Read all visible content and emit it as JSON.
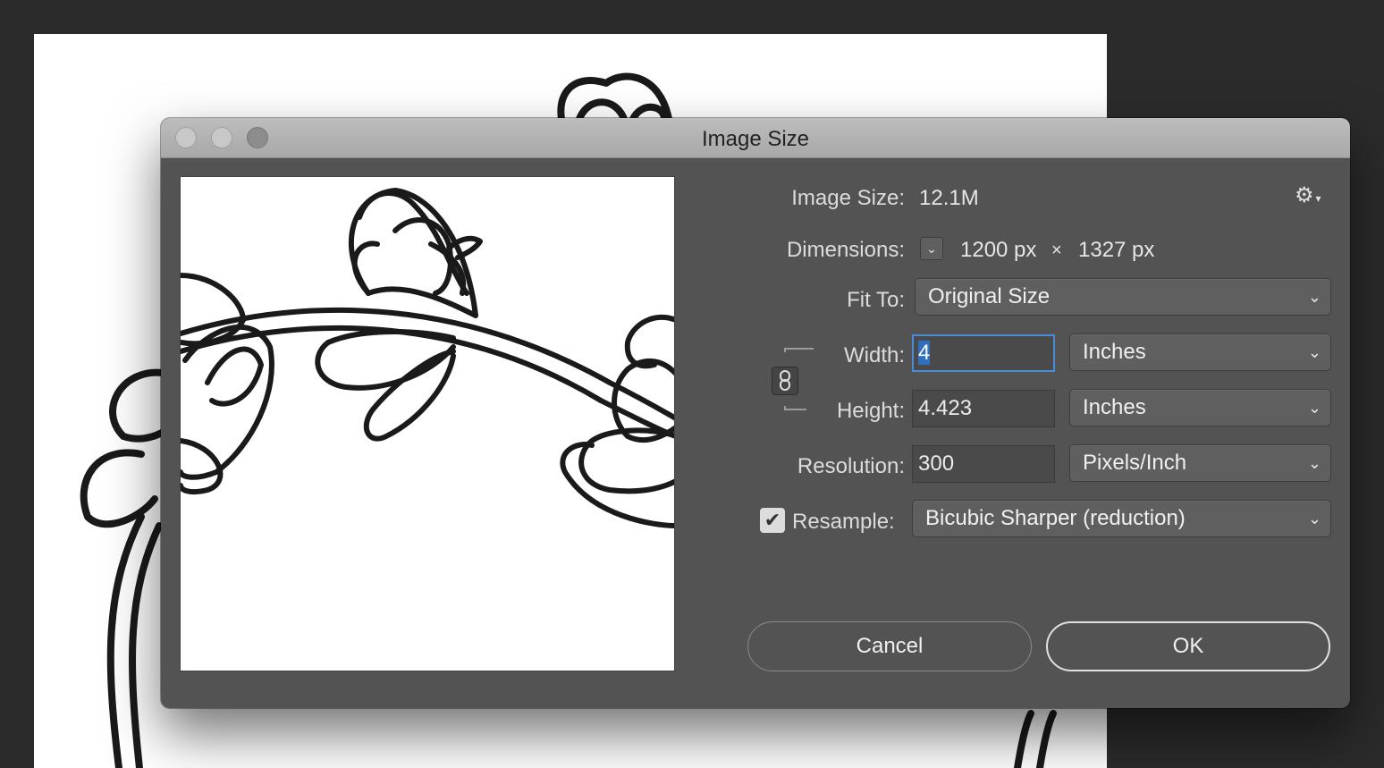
{
  "dialog": {
    "title": "Image Size"
  },
  "image_size": {
    "label": "Image Size:",
    "value": "12.1M"
  },
  "dimensions": {
    "label": "Dimensions:",
    "width": "1200 px",
    "sep": "×",
    "height": "1327 px"
  },
  "fit_to": {
    "label": "Fit To:",
    "value": "Original Size"
  },
  "width": {
    "label": "Width:",
    "value": "4",
    "unit": "Inches"
  },
  "height": {
    "label": "Height:",
    "value": "4.423",
    "unit": "Inches"
  },
  "resolution": {
    "label": "Resolution:",
    "value": "300",
    "unit": "Pixels/Inch"
  },
  "resample": {
    "label": "Resample:",
    "checked": true,
    "value": "Bicubic Sharper (reduction)"
  },
  "buttons": {
    "cancel": "Cancel",
    "ok": "OK"
  },
  "icons": {
    "settings": "gear-icon",
    "constrain": "chain-link-icon",
    "dropdown": "chevron-down-icon"
  }
}
